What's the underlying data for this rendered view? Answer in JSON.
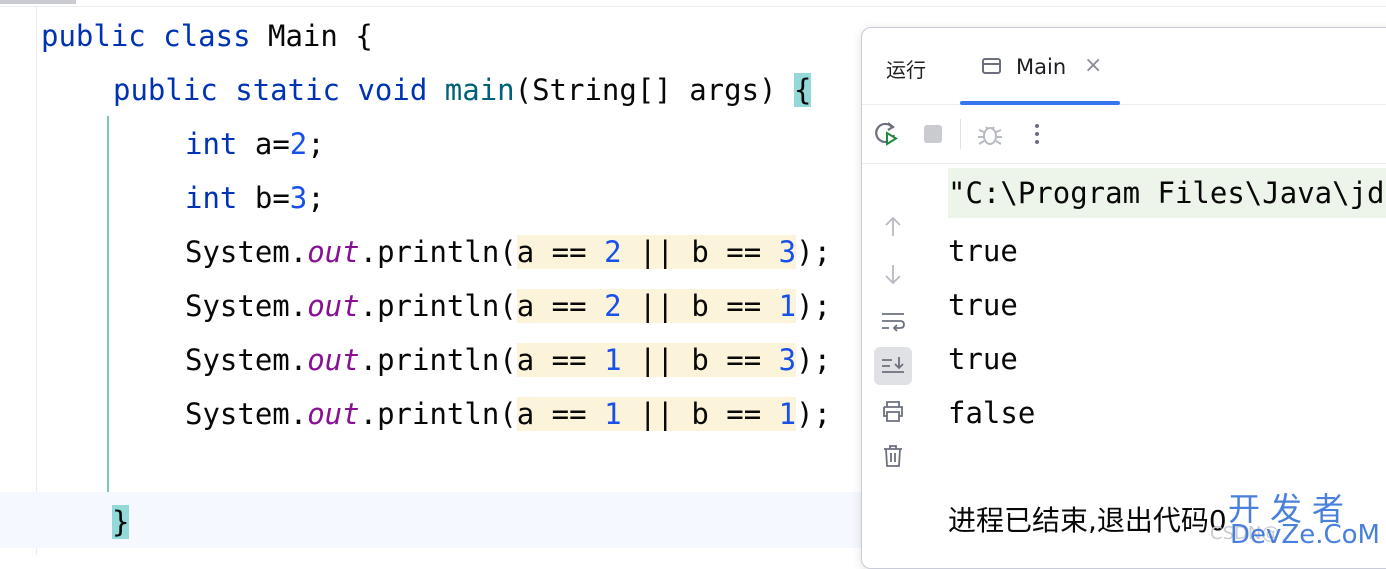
{
  "editor": {
    "lines": [
      {
        "k1": "public",
        "k2": "class",
        "name": "Main",
        "brace": "{"
      },
      {
        "k1": "public",
        "k2": "static",
        "k3": "void",
        "fn": "main",
        "params": "(String[] args) ",
        "brace": "{"
      },
      {
        "type": "int",
        "var": "a=",
        "num": "2",
        "end": ";"
      },
      {
        "type": "int",
        "var": "b=",
        "num": "3",
        "end": ";"
      },
      {
        "obj": "System.",
        "field": "out",
        "call": ".println(",
        "a": "a == ",
        "av": "2",
        "op": " || b == ",
        "bv": "3",
        "close": ");"
      },
      {
        "obj": "System.",
        "field": "out",
        "call": ".println(",
        "a": "a == ",
        "av": "2",
        "op": " || b == ",
        "bv": "1",
        "close": ");"
      },
      {
        "obj": "System.",
        "field": "out",
        "call": ".println(",
        "a": "a == ",
        "av": "1",
        "op": " || b == ",
        "bv": "3",
        "close": ");"
      },
      {
        "obj": "System.",
        "field": "out",
        "call": ".println(",
        "a": "a == ",
        "av": "1",
        "op": " || b == ",
        "bv": "1",
        "close": ");"
      },
      {
        "brace": "}"
      }
    ]
  },
  "run_panel": {
    "tab_run": "运行",
    "tab_main": "Main",
    "tab_close": "×",
    "console": {
      "command": "\"C:\\Program Files\\Java\\jd",
      "output": [
        "true",
        "true",
        "true",
        "false"
      ],
      "exit": "进程已结束,退出代码0"
    }
  },
  "watermark": {
    "main": "开发者",
    "sub": "DevZe.CoM",
    "faint": "CSDN@"
  },
  "colors": {
    "keyword": "#0033b3",
    "number": "#1750eb",
    "field": "#871094",
    "method": "#00627a",
    "tab_accent": "#3574f0"
  }
}
